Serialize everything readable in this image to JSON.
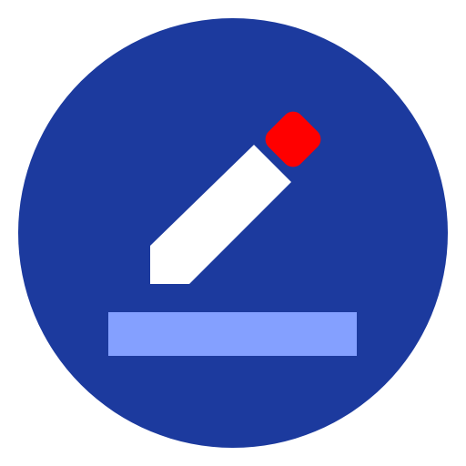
{
  "app_icon": {
    "name": "edit-pencil-app-icon",
    "colors": {
      "background": "#ffffff",
      "circle": "#1c3a9e",
      "pencil_body": "#ffffff",
      "pencil_eraser": "#ff0000",
      "underline": "#84a0ff"
    }
  }
}
